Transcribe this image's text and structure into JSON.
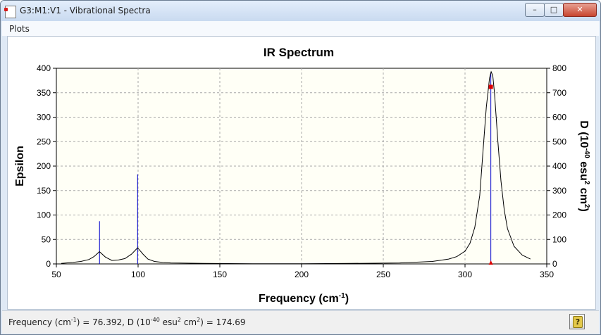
{
  "window": {
    "title": "G3:M1:V1 - Vibrational Spectra",
    "minimize_glyph": "–",
    "maximize_glyph": "□",
    "close_glyph": "✕",
    "app_icon": "document-icon"
  },
  "menu": {
    "items": [
      "Plots"
    ]
  },
  "status": {
    "freq_label": "Frequency (cm",
    "freq_unit_sup": "-1",
    "freq_value": ") = 76.392, D (10",
    "d_exp_sup": "-40",
    "d_unit": " esu",
    "d_unit_sup": "2",
    "d_unit2": " cm",
    "d_unit2_sup": "2",
    "d_value": ") = 174.69",
    "help_icon": "help-book-icon",
    "help_glyph": "?"
  },
  "chart_data": {
    "type": "line",
    "title": "IR Spectrum",
    "xlabel": {
      "text": "Frequency (cm",
      "sup": "-1",
      "tail": ")"
    },
    "ylabel_left": "Epsilon",
    "ylabel_right": {
      "p1": "D (10",
      "s1": "-40",
      "p2": " esu",
      "s2": "2",
      "p3": " cm",
      "s3": "2",
      "p4": ")"
    },
    "xlim": [
      50,
      350
    ],
    "ylim_left": [
      0,
      400
    ],
    "ylim_right": [
      0,
      800
    ],
    "x_ticks": [
      50,
      100,
      150,
      200,
      250,
      300,
      350
    ],
    "y_ticks_left": [
      0,
      50,
      100,
      150,
      200,
      250,
      300,
      350,
      400
    ],
    "y_ticks_right": [
      0,
      100,
      200,
      300,
      400,
      500,
      600,
      700,
      800
    ],
    "grid": true,
    "series": [
      {
        "axis": "left",
        "color": "#000000",
        "x": [
          53,
          60,
          65,
          70,
          73,
          76.4,
          80,
          84,
          88,
          92,
          96,
          99.7,
          103,
          106,
          110,
          115,
          120,
          140,
          170,
          200,
          230,
          260,
          280,
          290,
          295,
          300,
          303,
          306,
          309,
          311,
          313,
          315,
          316,
          317,
          318,
          320,
          322,
          324,
          326,
          330,
          335,
          340
        ],
        "y": [
          1,
          3,
          5,
          9,
          15,
          25,
          14,
          7,
          8,
          11,
          20,
          33,
          20,
          10,
          5,
          3,
          2,
          1,
          0.5,
          0.5,
          1,
          2,
          5,
          10,
          15,
          26,
          42,
          75,
          140,
          230,
          320,
          380,
          393,
          385,
          350,
          255,
          170,
          110,
          72,
          36,
          18,
          10
        ]
      }
    ],
    "sticks": {
      "axis": "right",
      "color": "#0000cc",
      "x": [
        76.4,
        99.7,
        315.8
      ],
      "y": [
        174.69,
        366,
        783
      ]
    },
    "markers": [
      {
        "shape": "square",
        "color": "#dd0000",
        "x": 315.8,
        "y_left": 362
      },
      {
        "shape": "triangle",
        "color": "#dd0000",
        "x": 315.8,
        "y_left": 0
      }
    ]
  }
}
